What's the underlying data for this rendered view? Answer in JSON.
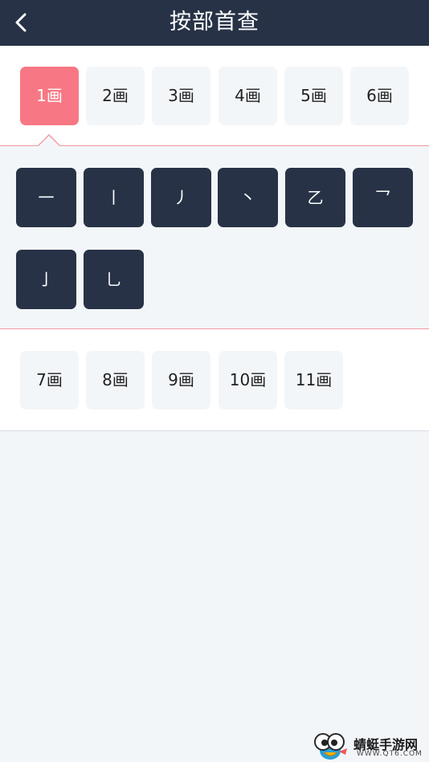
{
  "header": {
    "title": "按部首查",
    "back_icon": "chevron-left-icon"
  },
  "stroke_tabs_row1": [
    {
      "label": "1画",
      "active": true
    },
    {
      "label": "2画",
      "active": false
    },
    {
      "label": "3画",
      "active": false
    },
    {
      "label": "4画",
      "active": false
    },
    {
      "label": "5画",
      "active": false
    },
    {
      "label": "6画",
      "active": false
    }
  ],
  "radicals": [
    "一",
    "丨",
    "丿",
    "丶",
    "乙",
    "乛",
    "亅",
    "乚"
  ],
  "stroke_tabs_row2": [
    {
      "label": "7画"
    },
    {
      "label": "8画"
    },
    {
      "label": "9画"
    },
    {
      "label": "10画"
    },
    {
      "label": "11画"
    }
  ],
  "watermark": {
    "name": "蜻蜓手游网",
    "url": "WWW.QT6.COM"
  },
  "colors": {
    "header_bg": "#273246",
    "active_tab": "#f87784",
    "radical_bg": "#273246",
    "divider": "#f39aa3"
  }
}
